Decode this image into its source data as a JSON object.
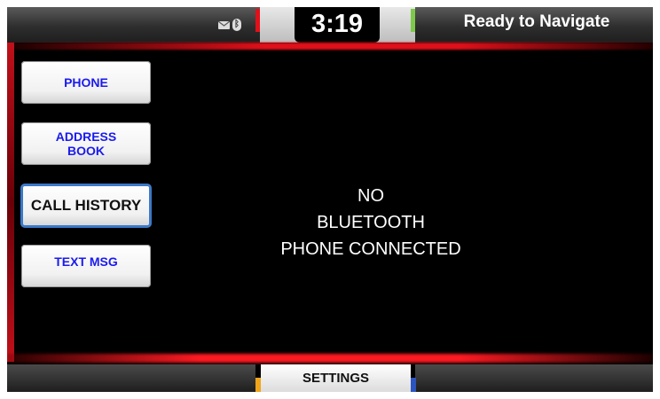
{
  "topbar": {
    "clock": "3:19",
    "nav_status": "Ready to Navigate",
    "icons": [
      "message-icon",
      "bluetooth-icon"
    ]
  },
  "sidebar": {
    "items": [
      {
        "label": "PHONE"
      },
      {
        "label": "ADDRESS BOOK"
      },
      {
        "label": "CALL HISTORY",
        "active": true
      },
      {
        "label": "TEXT MSG"
      }
    ]
  },
  "main": {
    "message_lines": [
      "NO",
      "BLUETOOTH",
      "PHONE CONNECTED"
    ]
  },
  "bottombar": {
    "settings_label": "SETTINGS"
  },
  "colors": {
    "accent_red": "#e0101a",
    "accent_green": "#7ec94a",
    "accent_orange": "#f0a51c",
    "accent_blue": "#2c55c0",
    "button_text": "#1a1aee"
  }
}
